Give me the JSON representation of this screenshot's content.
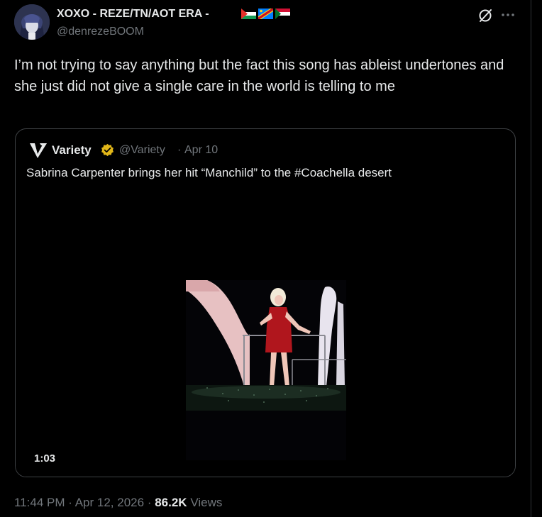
{
  "author": {
    "display_name": "XOXO - REZE/TN/AOT ERA -",
    "handle": "@denrezeBOOM",
    "flags": [
      "palestine-flag",
      "dr-congo-flag",
      "sudan-flag"
    ]
  },
  "tweet": {
    "text": "I’m not trying to say anything but the fact this song has ableist undertones and she just did not give a single care in the world is telling to me"
  },
  "quote": {
    "name": "Variety",
    "handle": "@Variety",
    "separator": "·",
    "date": "Apr 10",
    "text": "Sabrina Carpenter brings her hit “Manchild” to the #Coachella desert",
    "video_duration": "1:03"
  },
  "meta": {
    "time": "11:44 PM",
    "dot1": "·",
    "date": "Apr 12, 2026",
    "dot2": "·",
    "views_count": "86.2K",
    "views_label": "Views"
  },
  "colors": {
    "background": "#000000",
    "text_primary": "#e7e9ea",
    "text_secondary": "#71767b",
    "border": "#3e4144",
    "verified_gold": "#e2b719"
  },
  "icons": [
    "grok-icon",
    "more-icon",
    "variety-logo-icon",
    "verified-badge-icon"
  ]
}
